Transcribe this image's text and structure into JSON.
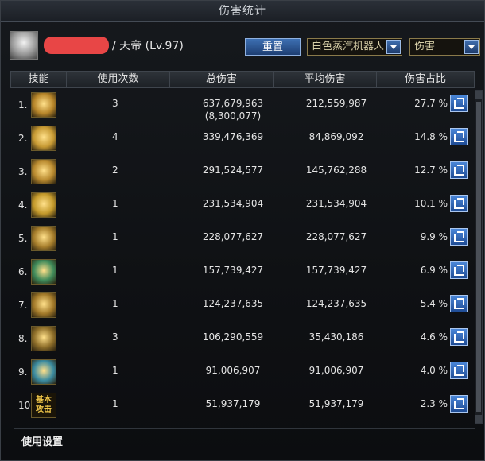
{
  "window": {
    "title": "伤害统计"
  },
  "header": {
    "name": "/ 天帝 (Lv.97)",
    "reset_label": "重置",
    "target_select": "白色蒸汽机器人",
    "mode_select": "伤害"
  },
  "table": {
    "columns": [
      "技能",
      "使用次数",
      "总伤害",
      "平均伤害",
      "伤害占比"
    ],
    "rows": [
      {
        "index": "1.",
        "icon": "skill-fire-slash-icon",
        "uses": "3",
        "total": "637,679,963",
        "total_sub": "(8,300,077)",
        "avg": "212,559,987",
        "share": "27.7 %"
      },
      {
        "index": "2.",
        "icon": "skill-star-burst-icon",
        "uses": "4",
        "total": "339,476,369",
        "total_sub": "",
        "avg": "84,869,092",
        "share": "14.8 %"
      },
      {
        "index": "3.",
        "icon": "skill-arrow-dash-icon",
        "uses": "2",
        "total": "291,524,577",
        "total_sub": "",
        "avg": "145,762,288",
        "share": "12.7 %"
      },
      {
        "index": "4.",
        "icon": "skill-hammer-icon",
        "uses": "1",
        "total": "231,534,904",
        "total_sub": "",
        "avg": "231,534,904",
        "share": "10.1 %"
      },
      {
        "index": "5.",
        "icon": "skill-vortex-icon",
        "uses": "1",
        "total": "228,077,627",
        "total_sub": "",
        "avg": "228,077,627",
        "share": "9.9 %"
      },
      {
        "index": "6.",
        "icon": "skill-lightning-icon",
        "uses": "1",
        "total": "157,739,427",
        "total_sub": "",
        "avg": "157,739,427",
        "share": "6.9 %"
      },
      {
        "index": "7.",
        "icon": "skill-crown-flame-icon",
        "uses": "1",
        "total": "124,237,635",
        "total_sub": "",
        "avg": "124,237,635",
        "share": "5.4 %"
      },
      {
        "index": "8.",
        "icon": "skill-seal-icon",
        "uses": "3",
        "total": "106,290,559",
        "total_sub": "",
        "avg": "35,430,186",
        "share": "4.6 %"
      },
      {
        "index": "9.",
        "icon": "skill-gear-cluster-icon",
        "uses": "1",
        "total": "91,006,907",
        "total_sub": "",
        "avg": "91,006,907",
        "share": "4.0 %"
      },
      {
        "index": "10.",
        "icon": "skill-basic-attack-icon",
        "icon_text": "基本\n攻击",
        "uses": "1",
        "total": "51,937,179",
        "total_sub": "",
        "avg": "51,937,179",
        "share": "2.3 %"
      }
    ]
  },
  "footer": {
    "settings_label": "使用设置"
  },
  "colors": {
    "accent_blue": "#3d6fb2",
    "panel_bg": "#0f1114",
    "gold": "#c8a24a"
  }
}
